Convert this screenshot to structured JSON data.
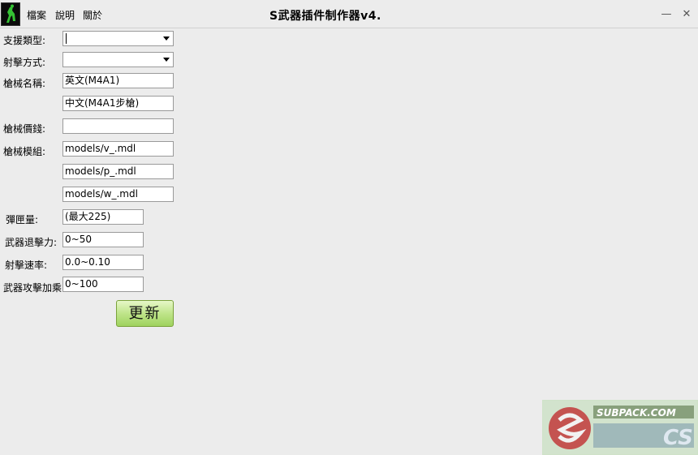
{
  "window": {
    "title": "S武器插件制作器v4.",
    "minimize_symbol": "—",
    "close_symbol": "✕"
  },
  "menu": [
    "檔案",
    "說明",
    "關於"
  ],
  "form": {
    "support_type": {
      "label": "支援類型:",
      "value": ""
    },
    "fire_mode": {
      "label": "射擊方式:",
      "value": ""
    },
    "gun_name": {
      "label": "槍械名稱:",
      "english_value": "英文(M4A1)",
      "chinese_value": "中文(M4A1步槍)"
    },
    "gun_price": {
      "label": "槍械價錢:",
      "value": ""
    },
    "gun_model": {
      "label": "槍械模組:",
      "v_model": "models/v_.mdl",
      "p_model": "models/p_.mdl",
      "w_model": "models/w_.mdl"
    },
    "ammo": {
      "label": "彈匣量:",
      "value": "(最大225)"
    },
    "recoil": {
      "label": "武器退擊力:",
      "value": "0~50"
    },
    "fire_rate": {
      "label": "射擊速率:",
      "value": "0.0~0.10"
    },
    "damage_mult": {
      "label": "武器攻擊加乘",
      "value": "0~100"
    }
  },
  "update_button": "更新",
  "watermark": {
    "site": "SUBPACK.COM",
    "brand": "CS"
  },
  "icons": {
    "app": "counter-strike-logo-icon",
    "dropdown": "chevron-down-icon"
  }
}
